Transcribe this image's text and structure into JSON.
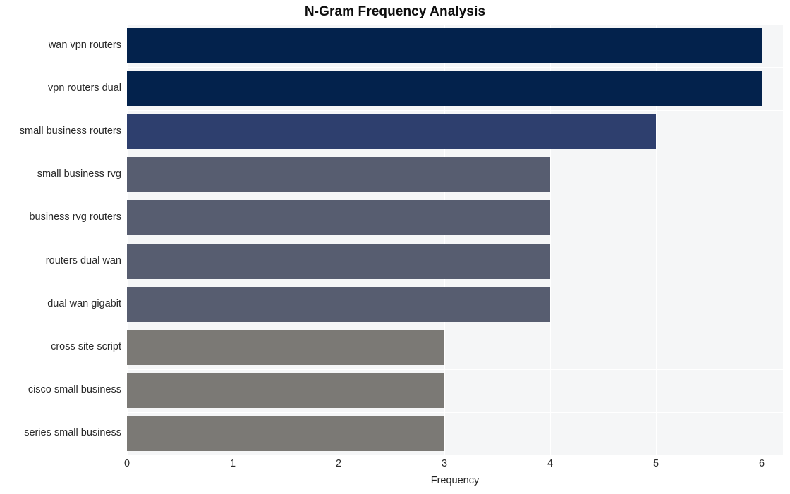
{
  "chart_data": {
    "type": "bar",
    "orientation": "horizontal",
    "title": "N-Gram Frequency Analysis",
    "xlabel": "Frequency",
    "ylabel": "",
    "xlim": [
      0,
      6.2
    ],
    "xticks": [
      0,
      1,
      2,
      3,
      4,
      5,
      6
    ],
    "xtick_labels": [
      "0",
      "1",
      "2",
      "3",
      "4",
      "5",
      "6"
    ],
    "grid": true,
    "legend": "none",
    "categories": [
      "wan vpn routers",
      "vpn routers dual",
      "small business routers",
      "small business rvg",
      "business rvg routers",
      "routers dual wan",
      "dual wan gigabit",
      "cross site script",
      "cisco small business",
      "series small business"
    ],
    "values": [
      6,
      6,
      5,
      4,
      4,
      4,
      4,
      3,
      3,
      3
    ],
    "bar_colors": [
      "#03224c",
      "#03224c",
      "#2e3f6e",
      "#575d70",
      "#575d70",
      "#575d70",
      "#575d70",
      "#7b7975",
      "#7b7975",
      "#7b7975"
    ]
  },
  "style": {
    "plot_background": "#f5f6f7",
    "grid_color": "#ffffff",
    "page_background": "#ffffff",
    "title_color": "#0d0d0d",
    "tick_color": "#2a2a2a"
  }
}
